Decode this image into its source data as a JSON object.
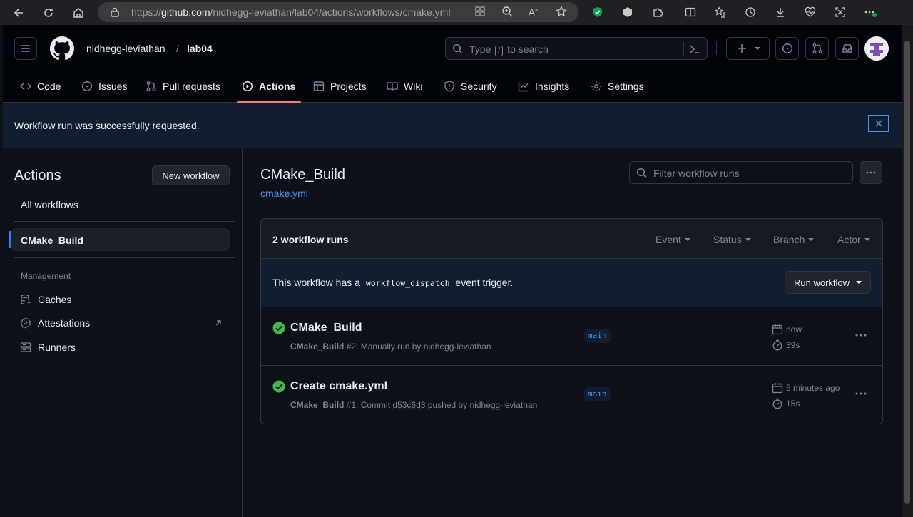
{
  "browser": {
    "url_prefix": "https://",
    "url_host": "github.com",
    "url_path": "/nidhegg-leviathan/lab04/actions/workflows/cmake.yml"
  },
  "header": {
    "owner": "nidhegg-leviathan",
    "separator": "/",
    "repo": "lab04",
    "search_pre": "Type",
    "search_key": "/",
    "search_post": "to search"
  },
  "nav": {
    "code": "Code",
    "issues": "Issues",
    "pulls": "Pull requests",
    "actions": "Actions",
    "projects": "Projects",
    "wiki": "Wiki",
    "security": "Security",
    "insights": "Insights",
    "settings": "Settings"
  },
  "flash": {
    "message": "Workflow run was successfully requested."
  },
  "sidebar": {
    "title": "Actions",
    "new_workflow": "New workflow",
    "all_workflows": "All workflows",
    "active_workflow": "CMake_Build",
    "management_heading": "Management",
    "caches": "Caches",
    "attestations": "Attestations",
    "runners": "Runners"
  },
  "main": {
    "title": "CMake_Build",
    "file": "cmake.yml",
    "filter_placeholder": "Filter workflow runs",
    "run_count": "2 workflow runs",
    "filters": {
      "event": "Event",
      "status": "Status",
      "branch": "Branch",
      "actor": "Actor"
    },
    "dispatch_pre": "This workflow has a",
    "dispatch_code": "workflow_dispatch",
    "dispatch_post": "event trigger.",
    "run_workflow": "Run workflow",
    "runs": [
      {
        "title": "CMake_Build",
        "workflow": "CMake_Build",
        "detail": "#2: Manually run by nidhegg-leviathan",
        "branch": "main",
        "time": "now",
        "duration": "39s"
      },
      {
        "title": "Create cmake.yml",
        "workflow": "CMake_Build",
        "detail_pre": "#1: Commit",
        "commit": "d53c6d3",
        "detail_post": "pushed by nidhegg-leviathan",
        "branch": "main",
        "time": "5 minutes ago",
        "duration": "15s"
      }
    ]
  },
  "colors": {
    "accent": "#2f81f7",
    "success": "#3fb950",
    "underline": "#f78166",
    "link": "#4493f8"
  }
}
